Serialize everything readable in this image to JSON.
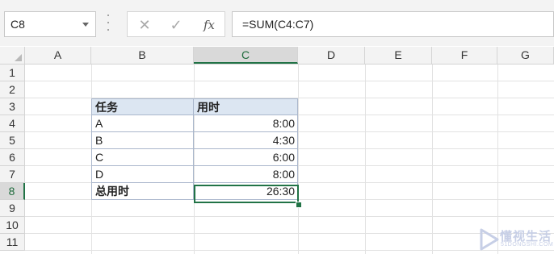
{
  "formula_bar": {
    "name_box": "C8",
    "cancel_icon": "✕",
    "enter_icon": "✓",
    "function_icon": "fx",
    "formula": "=SUM(C4:C7)"
  },
  "columns": [
    "A",
    "B",
    "C",
    "D",
    "E",
    "F",
    "G"
  ],
  "rows": [
    "1",
    "2",
    "3",
    "4",
    "5",
    "6",
    "7",
    "8",
    "9",
    "10",
    "11"
  ],
  "selection": {
    "column": "C",
    "row": "8"
  },
  "table": {
    "header": [
      "任务",
      "用时"
    ],
    "rows": [
      [
        "A",
        "8:00"
      ],
      [
        "B",
        "4:30"
      ],
      [
        "C",
        "6:00"
      ],
      [
        "D",
        "8:00"
      ]
    ],
    "total": [
      "总用时",
      "26:30"
    ]
  },
  "watermark": {
    "text": "懂视生活",
    "subtext": "51DONGSHI.COM"
  },
  "colors": {
    "accent": "#217346",
    "header_fill": "#dce6f2"
  }
}
